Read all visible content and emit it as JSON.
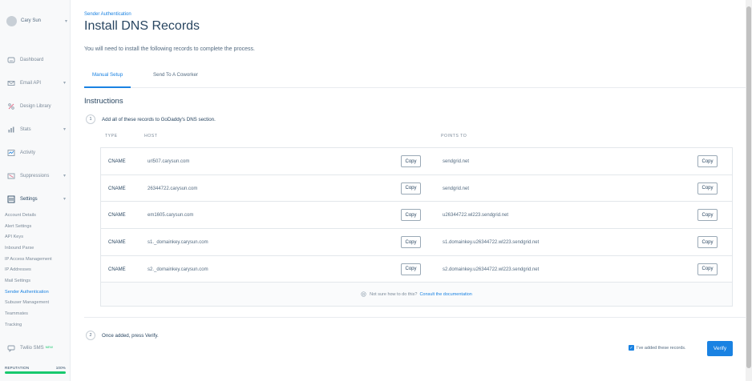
{
  "sidebar": {
    "user_name": "Cary Sun",
    "items": [
      {
        "label": "Dashboard",
        "icon": "dashboard-icon",
        "has_chevron": false
      },
      {
        "label": "Email API",
        "icon": "email-api-icon",
        "has_chevron": true
      },
      {
        "label": "Design Library",
        "icon": "design-library-icon",
        "has_chevron": false
      },
      {
        "label": "Stats",
        "icon": "stats-icon",
        "has_chevron": true
      },
      {
        "label": "Activity",
        "icon": "activity-icon",
        "has_chevron": false
      },
      {
        "label": "Suppressions",
        "icon": "suppressions-icon",
        "has_chevron": true
      },
      {
        "label": "Settings",
        "icon": "settings-icon",
        "has_chevron": true
      }
    ],
    "settings_sub": [
      "Account Details",
      "Alert Settings",
      "API Keys",
      "Inbound Parse",
      "IP Access Management",
      "IP Addresses",
      "Mail Settings",
      "Sender Authentication",
      "Subuser Management",
      "Teammates",
      "Tracking"
    ],
    "active_sub": "Sender Authentication",
    "twilio_label": "Twilio SMS",
    "twilio_badge": "NEW",
    "reputation_label": "REPUTATION",
    "reputation_value": "100%",
    "reputation_fraction": 1.0
  },
  "header": {
    "breadcrumb": "Sender Authentication",
    "title": "Install DNS Records",
    "description": "You will need to install the following records to complete the process."
  },
  "tabs": [
    {
      "label": "Manual Setup",
      "active": true
    },
    {
      "label": "Send To A Coworker",
      "active": false
    }
  ],
  "instructions": {
    "heading": "Instructions",
    "step1_num": "1",
    "step1_text": "Add all of these records to GoDaddy's DNS section.",
    "step2_num": "2",
    "step2_text": "Once added, press Verify."
  },
  "table": {
    "headers": {
      "type": "TYPE",
      "host": "HOST",
      "points_to": "POINTS TO"
    },
    "copy_label": "Copy",
    "rows": [
      {
        "type": "CNAME",
        "host": "url507.carysun.com",
        "points_to": "sendgrid.net"
      },
      {
        "type": "CNAME",
        "host": "26344722.carysun.com",
        "points_to": "sendgrid.net"
      },
      {
        "type": "CNAME",
        "host": "em1605.carysun.com",
        "points_to": "u26344722.wl223.sendgrid.net"
      },
      {
        "type": "CNAME",
        "host": "s1._domainkey.carysun.com",
        "points_to": "s1.domainkey.u26344722.wl223.sendgrid.net"
      },
      {
        "type": "CNAME",
        "host": "s2._domainkey.carysun.com",
        "points_to": "s2.domainkey.u26344722.wl223.sendgrid.net"
      }
    ],
    "help_text": "Not sure how to do this?",
    "help_link": "Consult the documentation"
  },
  "confirm": {
    "checkbox_label": "I've added these records.",
    "checked": true,
    "verify_label": "Verify"
  },
  "colors": {
    "accent": "#1a82e2",
    "text": "#294661",
    "success": "#18c96e"
  }
}
